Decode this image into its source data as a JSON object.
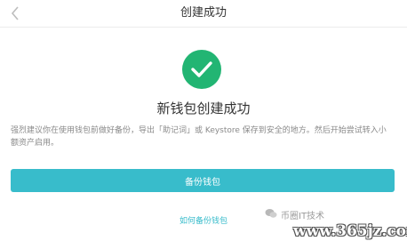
{
  "nav": {
    "title": "创建成功",
    "back_icon": "chevron-left-icon"
  },
  "success": {
    "icon": "checkmark-circle-icon",
    "icon_color": "#22b573",
    "title": "新钱包创建成功"
  },
  "description": "强烈建议你在使用钱包前做好备份，导出「助记词」或 Keystore 保存到安全的地方。然后开始尝试转入小额资产启用。",
  "primary_button": {
    "label": "备份钱包",
    "color": "#38bccb"
  },
  "help_link": "如何备份钱包",
  "watermark": {
    "small_text": "币圈IT技术",
    "url": "www.365jz.com"
  }
}
